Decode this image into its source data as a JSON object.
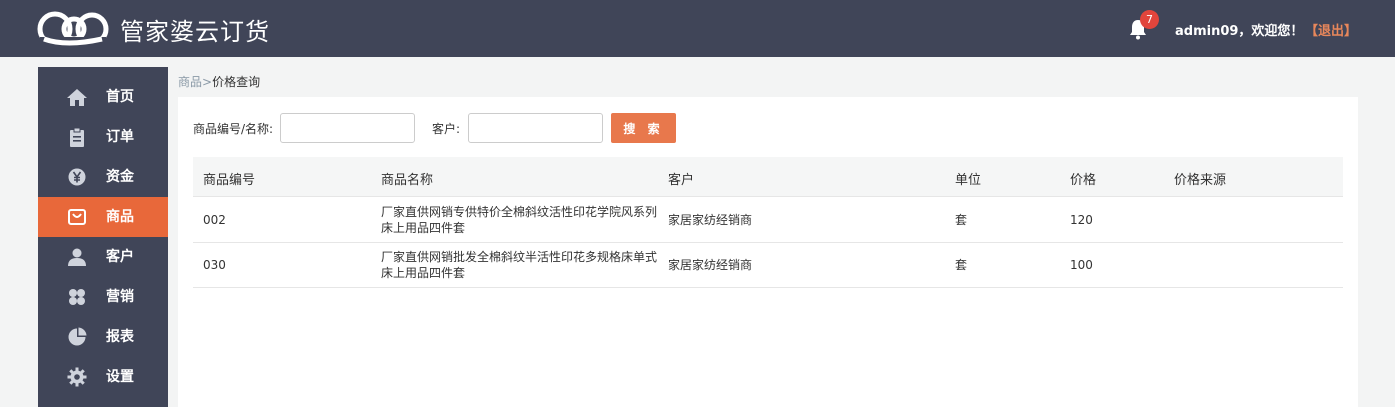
{
  "header": {
    "app_name": "管家婆云订货",
    "notification_count": "7",
    "welcome_text": "admin09，欢迎您！",
    "logout_label": "【退出】"
  },
  "sidebar": {
    "items": [
      {
        "label": "首页",
        "icon": "home-icon",
        "active": false
      },
      {
        "label": "订单",
        "icon": "clipboard-icon",
        "active": false
      },
      {
        "label": "资金",
        "icon": "yen-icon",
        "active": false
      },
      {
        "label": "商品",
        "icon": "bag-icon",
        "active": true
      },
      {
        "label": "客户",
        "icon": "user-icon",
        "active": false
      },
      {
        "label": "营销",
        "icon": "clover-icon",
        "active": false
      },
      {
        "label": "报表",
        "icon": "pie-chart-icon",
        "active": false
      },
      {
        "label": "设置",
        "icon": "gear-icon",
        "active": false
      }
    ]
  },
  "breadcrumb": {
    "parent": "商品",
    "separator": ">",
    "current": "价格查询"
  },
  "filters": {
    "product_label": "商品编号/名称:",
    "product_value": "",
    "customer_label": "客户:",
    "customer_value": "",
    "search_label": "搜 索"
  },
  "table": {
    "columns": [
      "商品编号",
      "商品名称",
      "客户",
      "单位",
      "价格",
      "价格来源"
    ],
    "rows": [
      {
        "code": "002",
        "name": "厂家直供网销专供特价全棉斜纹活性印花学院风系列床上用品四件套",
        "customer": "家居家纺经销商",
        "unit": "套",
        "price": "120",
        "source": ""
      },
      {
        "code": "030",
        "name": "厂家直供网销批发全棉斜纹半活性印花多规格床单式床上用品四件套",
        "customer": "家居家纺经销商",
        "unit": "套",
        "price": "100",
        "source": ""
      }
    ]
  },
  "colors": {
    "topbar": "#404558",
    "accent": "#e8683a",
    "badge": "#e2453c",
    "logout": "#e8875b"
  }
}
